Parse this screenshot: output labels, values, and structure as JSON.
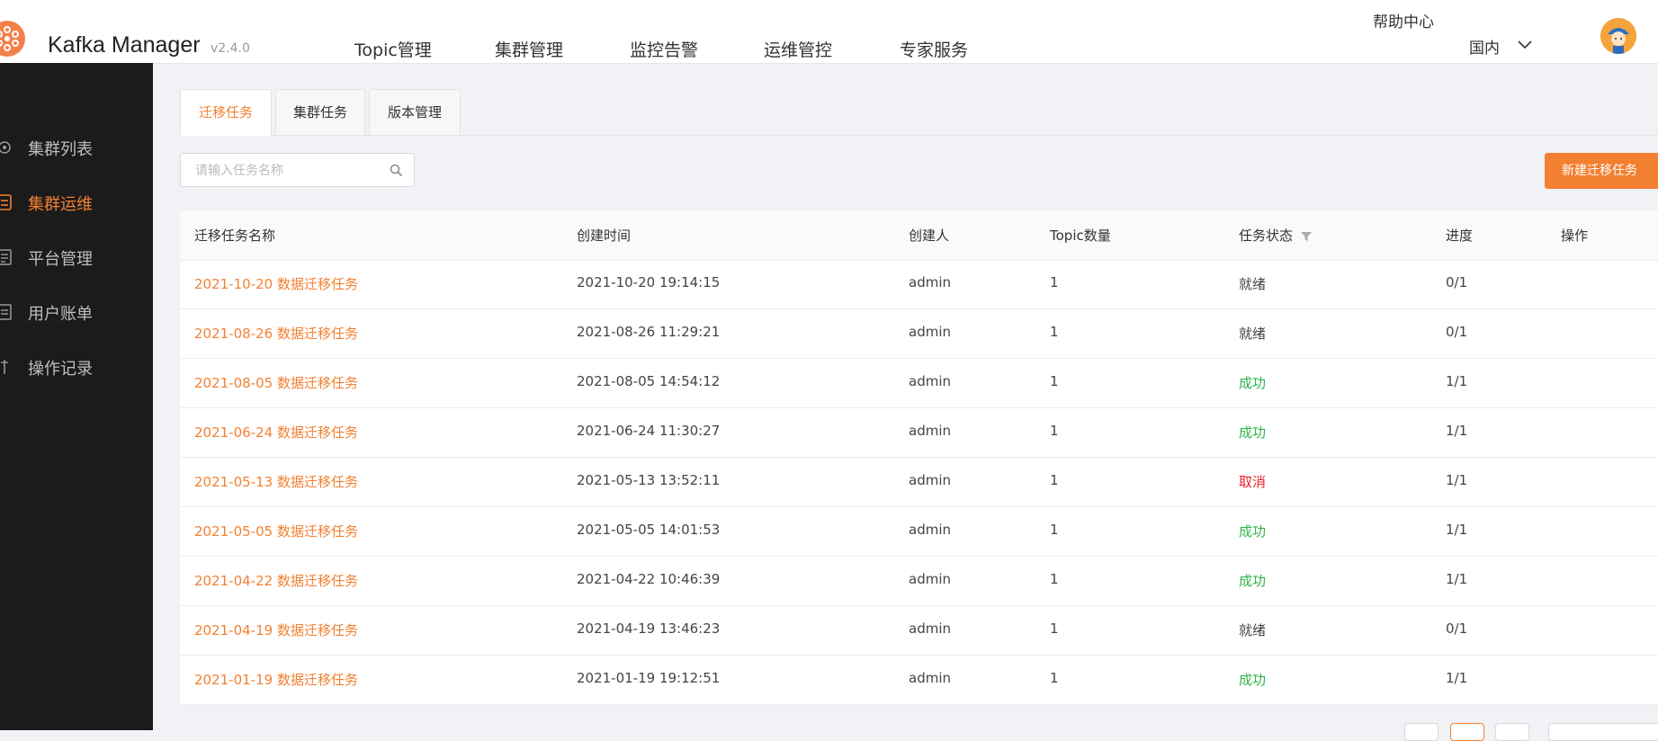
{
  "header": {
    "app_name": "Kafka Manager",
    "version": "v2.4.0",
    "nav": [
      {
        "label": "Topic管理"
      },
      {
        "label": "集群管理"
      },
      {
        "label": "监控告警"
      },
      {
        "label": "运维管控"
      },
      {
        "label": "专家服务"
      }
    ],
    "help_label": "帮助中心",
    "region_label": "国内"
  },
  "sidebar": {
    "items": [
      {
        "label": "集群列表",
        "icon": "cluster-icon",
        "active": false
      },
      {
        "label": "集群运维",
        "icon": "ops-icon",
        "active": true
      },
      {
        "label": "平台管理",
        "icon": "platform-icon",
        "active": false
      },
      {
        "label": "用户账单",
        "icon": "bill-icon",
        "active": false
      },
      {
        "label": "操作记录",
        "icon": "record-icon",
        "active": false
      }
    ]
  },
  "tabs": [
    {
      "label": "迁移任务",
      "active": true
    },
    {
      "label": "集群任务",
      "active": false
    },
    {
      "label": "版本管理",
      "active": false
    }
  ],
  "search": {
    "placeholder": "请输入任务名称",
    "value": ""
  },
  "new_task_button": "新建迁移任务",
  "table": {
    "columns": [
      "迁移任务名称",
      "创建时间",
      "创建人",
      "Topic数量",
      "任务状态",
      "进度",
      "操作"
    ],
    "rows": [
      {
        "name": "2021-10-20 数据迁移任务",
        "created": "2021-10-20 19:14:15",
        "creator": "admin",
        "topics": "1",
        "status": "就绪",
        "status_color": "#444444",
        "progress": "0/1"
      },
      {
        "name": "2021-08-26 数据迁移任务",
        "created": "2021-08-26 11:29:21",
        "creator": "admin",
        "topics": "1",
        "status": "就绪",
        "status_color": "#444444",
        "progress": "0/1"
      },
      {
        "name": "2021-08-05 数据迁移任务",
        "created": "2021-08-05 14:54:12",
        "creator": "admin",
        "topics": "1",
        "status": "成功",
        "status_color": "#2fb34a",
        "progress": "1/1"
      },
      {
        "name": "2021-06-24 数据迁移任务",
        "created": "2021-06-24 11:30:27",
        "creator": "admin",
        "topics": "1",
        "status": "成功",
        "status_color": "#2fb34a",
        "progress": "1/1"
      },
      {
        "name": "2021-05-13 数据迁移任务",
        "created": "2021-05-13 13:52:11",
        "creator": "admin",
        "topics": "1",
        "status": "取消",
        "status_color": "#e8202a",
        "progress": "1/1"
      },
      {
        "name": "2021-05-05 数据迁移任务",
        "created": "2021-05-05 14:01:53",
        "creator": "admin",
        "topics": "1",
        "status": "成功",
        "status_color": "#2fb34a",
        "progress": "1/1"
      },
      {
        "name": "2021-04-22 数据迁移任务",
        "created": "2021-04-22 10:46:39",
        "creator": "admin",
        "topics": "1",
        "status": "成功",
        "status_color": "#2fb34a",
        "progress": "1/1"
      },
      {
        "name": "2021-04-19 数据迁移任务",
        "created": "2021-04-19 13:46:23",
        "creator": "admin",
        "topics": "1",
        "status": "就绪",
        "status_color": "#444444",
        "progress": "0/1"
      },
      {
        "name": "2021-01-19 数据迁移任务",
        "created": "2021-01-19 19:12:51",
        "creator": "admin",
        "topics": "1",
        "status": "成功",
        "status_color": "#2fb34a",
        "progress": "1/1"
      }
    ]
  },
  "colors": {
    "accent": "#f38031",
    "sidebar_bg": "#1b1b1b",
    "success": "#2fb34a",
    "cancel": "#e8202a"
  }
}
